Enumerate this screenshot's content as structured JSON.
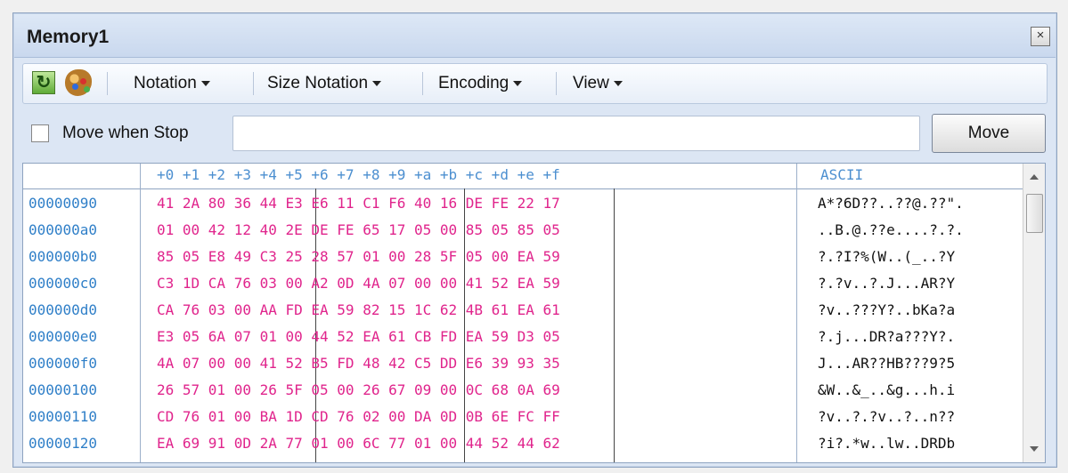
{
  "window": {
    "title": "Memory1"
  },
  "toolbar": {
    "notation": "Notation",
    "size_notation": "Size Notation",
    "encoding": "Encoding",
    "view": "View"
  },
  "controls": {
    "move_when_stop": "Move when Stop",
    "address_value": "",
    "move_button": "Move"
  },
  "grid": {
    "header_offsets": "+0 +1 +2 +3 +4 +5 +6 +7 +8 +9 +a +b +c +d +e +f",
    "header_ascii": "ASCII",
    "rows": [
      {
        "address": "00000090",
        "bytes": "41 2A 80 36 44 E3 E6 11 C1 F6 40 16 DE FE 22 17",
        "ascii": "A*?6D??..??@.??\"."
      },
      {
        "address": "000000a0",
        "bytes": "01 00 42 12 40 2E DE FE 65 17 05 00 85 05 85 05",
        "ascii": "..B.@.??e....?.?."
      },
      {
        "address": "000000b0",
        "bytes": "85 05 E8 49 C3 25 28 57 01 00 28 5F 05 00 EA 59",
        "ascii": "?.?I?%(W..(_..?Y"
      },
      {
        "address": "000000c0",
        "bytes": "C3 1D CA 76 03 00 A2 0D 4A 07 00 00 41 52 EA 59",
        "ascii": "?.?v..?.J...AR?Y"
      },
      {
        "address": "000000d0",
        "bytes": "CA 76 03 00 AA FD EA 59 82 15 1C 62 4B 61 EA 61",
        "ascii": "?v..???Y?..bKa?a"
      },
      {
        "address": "000000e0",
        "bytes": "E3 05 6A 07 01 00 44 52 EA 61 CB FD EA 59 D3 05",
        "ascii": "?.j...DR?a???Y?."
      },
      {
        "address": "000000f0",
        "bytes": "4A 07 00 00 41 52 B5 FD 48 42 C5 DD E6 39 93 35",
        "ascii": "J...AR??HB???9?5"
      },
      {
        "address": "00000100",
        "bytes": "26 57 01 00 26 5F 05 00 26 67 09 00 0C 68 0A 69",
        "ascii": "&W..&_..&g...h.i"
      },
      {
        "address": "00000110",
        "bytes": "CD 76 01 00 BA 1D CD 76 02 00 DA 0D 0B 6E FC FF",
        "ascii": "?v..?.?v..?..n??"
      },
      {
        "address": "00000120",
        "bytes": "EA 69 91 0D 2A 77 01 00 6C 77 01 00 44 52 44 62",
        "ascii": "?i?.*w..lw..DRDb"
      }
    ]
  }
}
